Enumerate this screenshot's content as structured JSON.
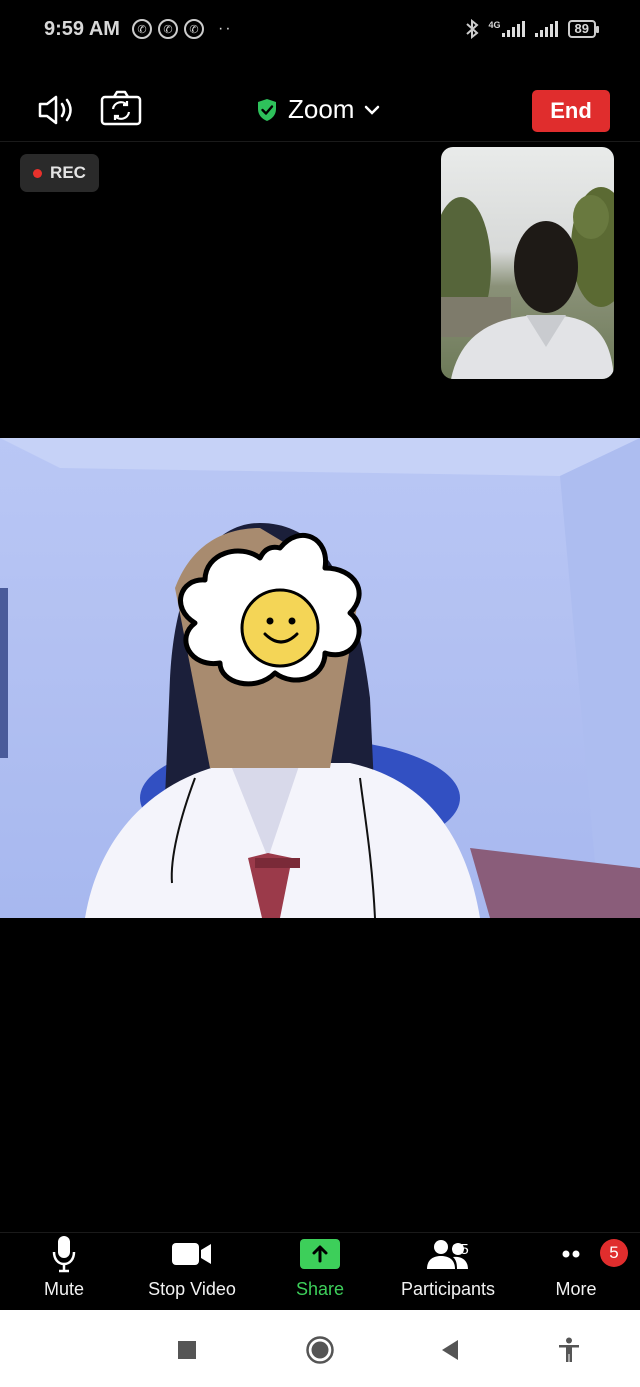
{
  "status_bar": {
    "time": "9:59 AM",
    "network": "4G",
    "battery": "89",
    "dots": "··"
  },
  "top_bar": {
    "meeting_title": "Zoom",
    "end_label": "End"
  },
  "recording": {
    "label": "REC"
  },
  "toolbar": {
    "mute_label": "Mute",
    "stop_video_label": "Stop Video",
    "share_label": "Share",
    "participants_label": "Participants",
    "participants_count": "85",
    "more_label": "More",
    "more_badge": "5"
  },
  "colors": {
    "end_button": "#e02d2d",
    "share_green": "#3dcf5a",
    "shield_green": "#2ec15b"
  },
  "icons": [
    "speaker-icon",
    "camera-switch-icon",
    "shield-icon",
    "chevron-down-icon",
    "microphone-icon",
    "video-camera-icon",
    "share-arrow-icon",
    "participants-icon",
    "more-dots-icon",
    "stop-icon",
    "home-icon",
    "back-icon",
    "accessibility-icon"
  ]
}
